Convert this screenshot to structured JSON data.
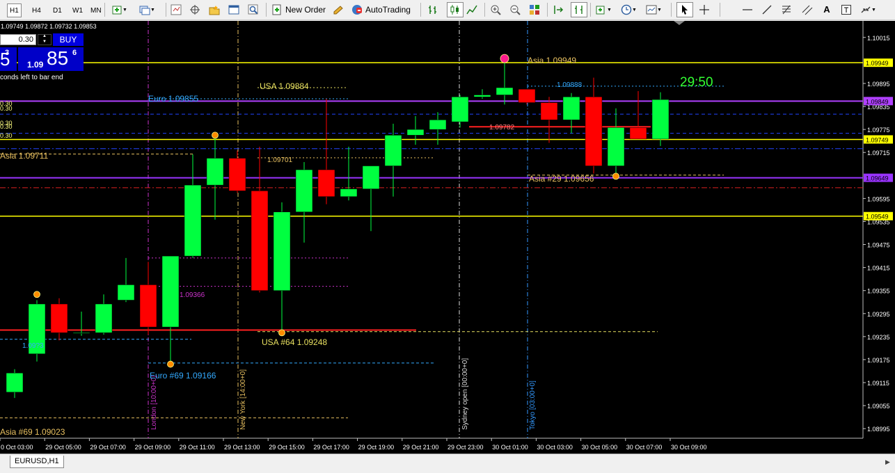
{
  "toolbar": {
    "timeframes": [
      "H1",
      "H4",
      "D1",
      "W1",
      "MN"
    ],
    "active_timeframe": "H1",
    "new_order_label": "New Order",
    "autotrading_label": "AutoTrading"
  },
  "chart_header": {
    "ohlc": "1.09749 1.09872 1.09732 1.09853"
  },
  "one_click": {
    "lot": "0.30",
    "buy_label": "BUY",
    "price_prefix": "1.09",
    "price_big": "85",
    "price_sup": "6",
    "sell_big": "5",
    "sell_sup": "3",
    "countdown_text": "conds left to bar end"
  },
  "price_axis": {
    "ticks": [
      "1.10015",
      "1.09895",
      "1.09835",
      "1.09775",
      "1.09715",
      "1.09595",
      "1.09535",
      "1.09475",
      "1.09415",
      "1.09355",
      "1.09295",
      "1.09235",
      "1.09175",
      "1.09115",
      "1.09055",
      "1.08995"
    ],
    "markers": [
      {
        "label": "1.09949",
        "color": "#ffff00",
        "text": "#000000"
      },
      {
        "label": "1.09849",
        "color": "#b040ff",
        "text": "#000000"
      },
      {
        "label": "1.09749",
        "color": "#ffff00",
        "text": "#000000"
      },
      {
        "label": "1.09649",
        "color": "#9933ff",
        "text": "#000000"
      },
      {
        "label": "1.09549",
        "color": "#ffff00",
        "text": "#000000"
      }
    ]
  },
  "time_axis": [
    "0 Oct 03:00",
    "29 Oct 05:00",
    "29 Oct 07:00",
    "29 Oct 09:00",
    "29 Oct 11:00",
    "29 Oct 13:00",
    "29 Oct 15:00",
    "29 Oct 17:00",
    "29 Oct 19:00",
    "29 Oct 21:00",
    "29 Oct 23:00",
    "30 Oct 01:00",
    "30 Oct 03:00",
    "30 Oct 05:00",
    "30 Oct 07:00",
    "30 Oct 09:00"
  ],
  "annotations": {
    "usa_high": "USA 1.09884",
    "euro_high": "Euro 1.09855",
    "asia_high": "Asia 1.09949",
    "asia_left": "Asia 1.09711",
    "value_09701": "1.09701",
    "value_09782": "1.09782",
    "value_09888": "1.09888",
    "asia_29": "Asia #29 1.09656",
    "value_09366": "1.09366",
    "usa_64": "USA #64 1.09248",
    "euro_69": "Euro #69 1.09166",
    "asia_69": "Asia #69 1.09023",
    "value_left_low": "1.09?3",
    "timer": "29:50",
    "left_stack": [
      "0.30",
      "0.30",
      "0.30",
      "0.30",
      "0.30"
    ]
  },
  "sessions": {
    "london": "London [10:00+0]",
    "newyork": "New York [14:00+0]",
    "sydney": "Sydney open [00:00+0]",
    "tokyo": "Tokyo [03:00+0]"
  },
  "chart_data": {
    "type": "candlestick",
    "symbol": "EURUSD",
    "timeframe": "H1",
    "ylim": [
      1.0897,
      1.1004
    ],
    "candles": [
      {
        "o": 1.0909,
        "h": 1.0915,
        "l": 1.09075,
        "c": 1.0914
      },
      {
        "o": 1.0919,
        "h": 1.0933,
        "l": 1.0917,
        "c": 1.0932
      },
      {
        "o": 1.0932,
        "h": 1.09335,
        "l": 1.09225,
        "c": 1.09245
      },
      {
        "o": 1.09245,
        "h": 1.093,
        "l": 1.09237,
        "c": 1.09245
      },
      {
        "o": 1.09245,
        "h": 1.09345,
        "l": 1.0924,
        "c": 1.0932
      },
      {
        "o": 1.0933,
        "h": 1.0944,
        "l": 1.09325,
        "c": 1.0937
      },
      {
        "o": 1.0937,
        "h": 1.0943,
        "l": 1.0924,
        "c": 1.0926
      },
      {
        "o": 1.0926,
        "h": 1.09445,
        "l": 1.09166,
        "c": 1.09445
      },
      {
        "o": 1.09445,
        "h": 1.0971,
        "l": 1.0944,
        "c": 1.0963
      },
      {
        "o": 1.0963,
        "h": 1.0976,
        "l": 1.0954,
        "c": 1.097
      },
      {
        "o": 1.097,
        "h": 1.0972,
        "l": 1.0961,
        "c": 1.09615
      },
      {
        "o": 1.09615,
        "h": 1.0973,
        "l": 1.0935,
        "c": 1.09355
      },
      {
        "o": 1.09355,
        "h": 1.09585,
        "l": 1.09248,
        "c": 1.0956
      },
      {
        "o": 1.0956,
        "h": 1.0969,
        "l": 1.0948,
        "c": 1.0967
      },
      {
        "o": 1.0967,
        "h": 1.09855,
        "l": 1.0958,
        "c": 1.096
      },
      {
        "o": 1.096,
        "h": 1.0973,
        "l": 1.0959,
        "c": 1.0962
      },
      {
        "o": 1.0962,
        "h": 1.0968,
        "l": 1.0951,
        "c": 1.0968
      },
      {
        "o": 1.0968,
        "h": 1.0979,
        "l": 1.096,
        "c": 1.0976
      },
      {
        "o": 1.0976,
        "h": 1.0981,
        "l": 1.09735,
        "c": 1.09775
      },
      {
        "o": 1.09775,
        "h": 1.0982,
        "l": 1.09735,
        "c": 1.098
      },
      {
        "o": 1.09795,
        "h": 1.09865,
        "l": 1.0978,
        "c": 1.0986
      },
      {
        "o": 1.0986,
        "h": 1.0988,
        "l": 1.09855,
        "c": 1.09865
      },
      {
        "o": 1.09865,
        "h": 1.09949,
        "l": 1.0984,
        "c": 1.09884
      },
      {
        "o": 1.0988,
        "h": 1.0988,
        "l": 1.0984,
        "c": 1.09845
      },
      {
        "o": 1.09845,
        "h": 1.0986,
        "l": 1.0974,
        "c": 1.098
      },
      {
        "o": 1.098,
        "h": 1.0987,
        "l": 1.09765,
        "c": 1.0986
      },
      {
        "o": 1.0986,
        "h": 1.0991,
        "l": 1.0966,
        "c": 1.0968
      },
      {
        "o": 1.0968,
        "h": 1.0983,
        "l": 1.09656,
        "c": 1.0978
      },
      {
        "o": 1.0978,
        "h": 1.09875,
        "l": 1.0975,
        "c": 1.0975
      },
      {
        "o": 1.0975,
        "h": 1.09872,
        "l": 1.09732,
        "c": 1.09853
      }
    ]
  },
  "status": {
    "tab_label": "EURUSD,H1"
  }
}
